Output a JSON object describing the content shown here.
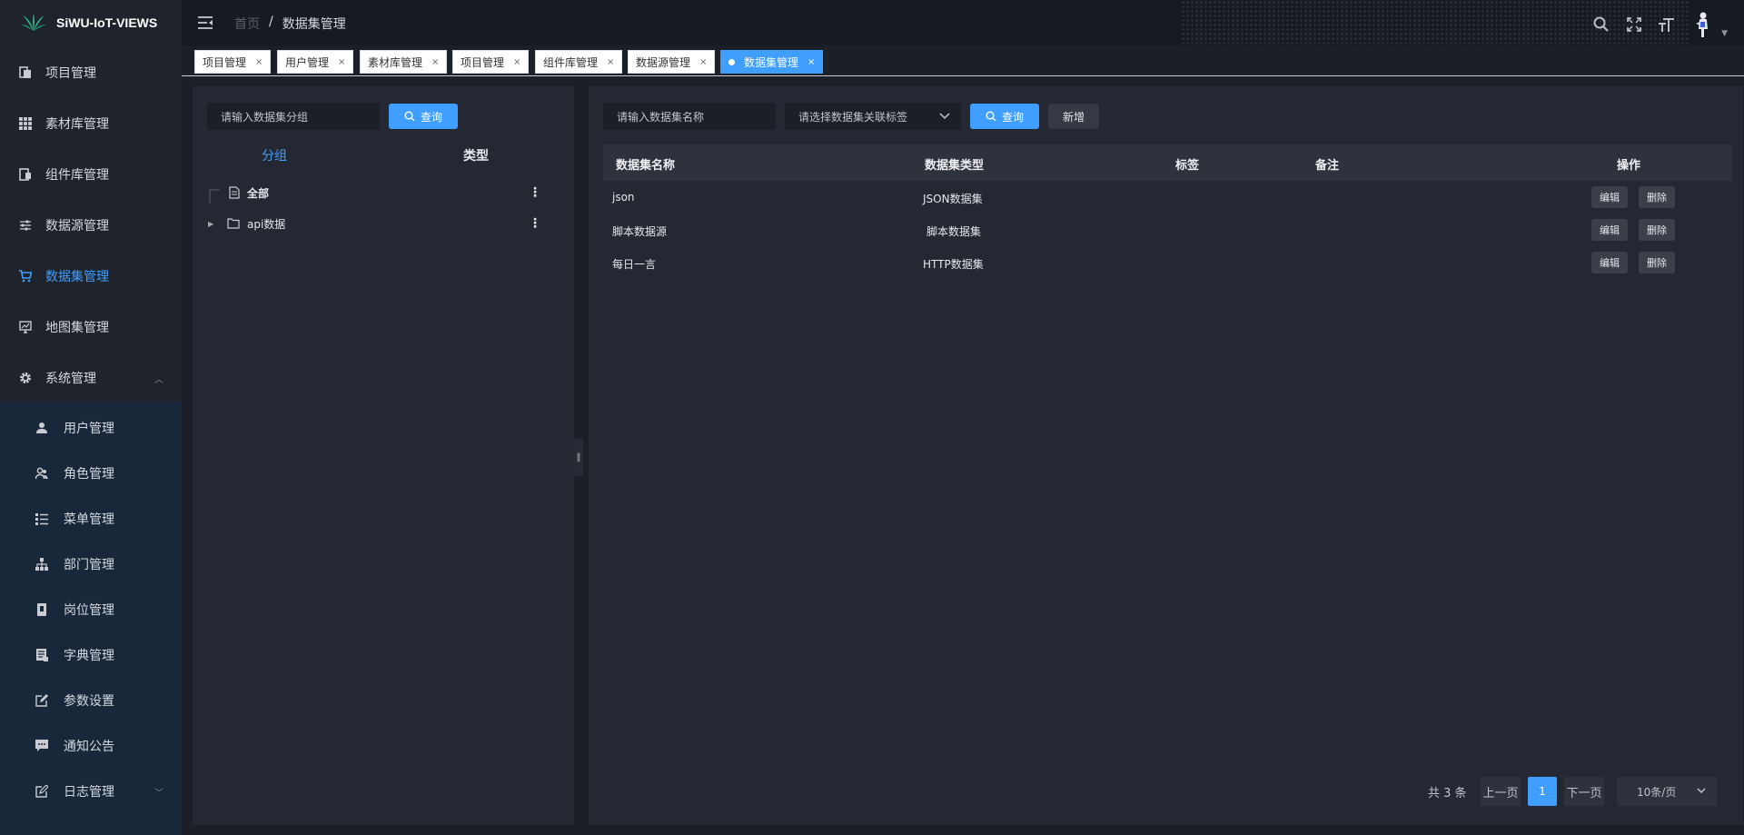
{
  "app": {
    "name": "SiWU-IoT-VIEWS"
  },
  "sidebar": {
    "items": [
      {
        "label": "项目管理",
        "icon": "project-icon"
      },
      {
        "label": "素材库管理",
        "icon": "grid-icon"
      },
      {
        "label": "组件库管理",
        "icon": "component-icon"
      },
      {
        "label": "数据源管理",
        "icon": "sliders-icon"
      },
      {
        "label": "数据集管理",
        "icon": "cart-icon"
      },
      {
        "label": "地图集管理",
        "icon": "monitor-icon"
      },
      {
        "label": "系统管理",
        "icon": "gear-icon"
      }
    ],
    "sub_items": [
      {
        "label": "用户管理",
        "icon": "user-icon"
      },
      {
        "label": "角色管理",
        "icon": "users-icon"
      },
      {
        "label": "菜单管理",
        "icon": "list-icon"
      },
      {
        "label": "部门管理",
        "icon": "org-icon"
      },
      {
        "label": "岗位管理",
        "icon": "badge-icon"
      },
      {
        "label": "字典管理",
        "icon": "book-icon"
      },
      {
        "label": "参数设置",
        "icon": "edit-icon"
      },
      {
        "label": "通知公告",
        "icon": "message-icon"
      },
      {
        "label": "日志管理",
        "icon": "log-icon"
      }
    ]
  },
  "header": {
    "breadcrumb": {
      "home": "首页",
      "separator": "/",
      "current": "数据集管理"
    }
  },
  "tabs": [
    "项目管理",
    "用户管理",
    "素材库管理",
    "项目管理",
    "组件库管理",
    "数据源管理",
    "数据集管理"
  ],
  "tab_close": "×",
  "left_panel": {
    "search_placeholder": "请输入数据集分组",
    "search_button": "查询",
    "segments": [
      "分组",
      "类型"
    ],
    "tree": [
      {
        "label": "全部"
      },
      {
        "label": "api数据"
      }
    ]
  },
  "right_panel": {
    "name_placeholder": "请输入数据集名称",
    "tag_placeholder": "请选择数据集关联标签",
    "search_button": "查询",
    "add_button": "新增",
    "columns": [
      "数据集名称",
      "数据集类型",
      "标签",
      "备注",
      "操作"
    ],
    "rows": [
      {
        "name": "json",
        "type": "JSON数据集",
        "tag": "",
        "note": ""
      },
      {
        "name": "脚本数据源",
        "type": "脚本数据集",
        "tag": "",
        "note": ""
      },
      {
        "name": "每日一言",
        "type": "HTTP数据集",
        "tag": "",
        "note": ""
      }
    ],
    "edit_label": "编辑",
    "delete_label": "删除",
    "pagination": {
      "total": "共 3 条",
      "prev": "上一页",
      "page": "1",
      "next": "下一页",
      "page_size": "10条/页"
    }
  },
  "colors": {
    "accent": "#409eff",
    "sidebar_bg": "#1f232c",
    "panel_bg": "#232833",
    "submenu_bg": "#18273a"
  }
}
